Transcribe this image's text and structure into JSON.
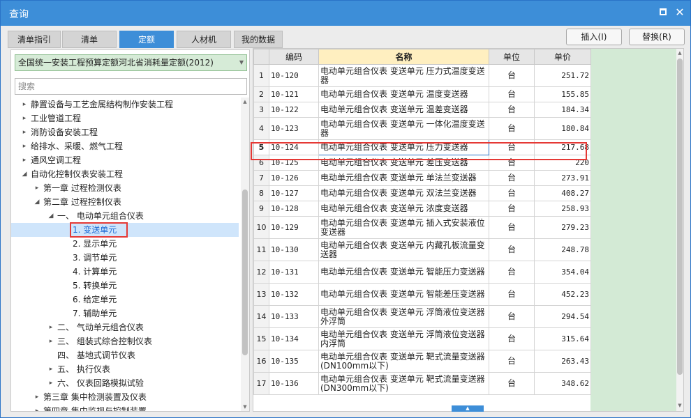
{
  "window": {
    "title": "查询"
  },
  "tabs": [
    {
      "label": "清单指引",
      "active": false
    },
    {
      "label": "清单",
      "active": false
    },
    {
      "label": "定额",
      "active": true
    },
    {
      "label": "人材机",
      "active": false
    },
    {
      "label": "我的数据",
      "active": false
    }
  ],
  "buttons": {
    "insert": "插入(I)",
    "replace": "替换(R)"
  },
  "left": {
    "dropdown_value": "全国统一安装工程预算定额河北省消耗量定额(2012)",
    "search_placeholder": "搜索",
    "tree": [
      {
        "label": "静置设备与工艺金属结构制作安装工程",
        "level": 0,
        "toggle": "▸"
      },
      {
        "label": "工业管道工程",
        "level": 0,
        "toggle": "▸"
      },
      {
        "label": "消防设备安装工程",
        "level": 0,
        "toggle": "▸"
      },
      {
        "label": "给排水、采暖、燃气工程",
        "level": 0,
        "toggle": "▸"
      },
      {
        "label": "通风空调工程",
        "level": 0,
        "toggle": "▸"
      },
      {
        "label": "自动化控制仪表安装工程",
        "level": 0,
        "toggle": "◢"
      },
      {
        "label": "第一章 过程检测仪表",
        "level": 1,
        "toggle": "▸"
      },
      {
        "label": "第二章 过程控制仪表",
        "level": 1,
        "toggle": "◢"
      },
      {
        "label": "一、 电动单元组合仪表",
        "level": 2,
        "toggle": "◢"
      },
      {
        "label": "1. 变送单元",
        "level": 3,
        "toggle": "",
        "selected": true
      },
      {
        "label": "2. 显示单元",
        "level": 3,
        "toggle": ""
      },
      {
        "label": "3. 调节单元",
        "level": 3,
        "toggle": ""
      },
      {
        "label": "4. 计算单元",
        "level": 3,
        "toggle": ""
      },
      {
        "label": "5. 转换单元",
        "level": 3,
        "toggle": ""
      },
      {
        "label": "6. 给定单元",
        "level": 3,
        "toggle": ""
      },
      {
        "label": "7. 辅助单元",
        "level": 3,
        "toggle": ""
      },
      {
        "label": "二、 气动单元组合仪表",
        "level": 2,
        "toggle": "▸"
      },
      {
        "label": "三、 组装式综合控制仪表",
        "level": 2,
        "toggle": "▸"
      },
      {
        "label": "四、 基地式调节仪表",
        "level": 2,
        "toggle": ""
      },
      {
        "label": "五、 执行仪表",
        "level": 2,
        "toggle": "▸"
      },
      {
        "label": "六、 仪表回路模拟试验",
        "level": 2,
        "toggle": "▸"
      },
      {
        "label": "第三章 集中检测装置及仪表",
        "level": 1,
        "toggle": "▸"
      },
      {
        "label": "第四章 集中监视与控制装置",
        "level": 1,
        "toggle": "▸"
      }
    ]
  },
  "table": {
    "headers": [
      "",
      "编码",
      "名称",
      "单位",
      "单价"
    ],
    "rows": [
      {
        "no": "1",
        "code": "10-120",
        "name": "电动单元组合仪表 变送单元 压力式温度变送器",
        "unit": "台",
        "price": "251.72"
      },
      {
        "no": "2",
        "code": "10-121",
        "name": "电动单元组合仪表 变送单元 温度变送器",
        "unit": "台",
        "price": "155.85"
      },
      {
        "no": "3",
        "code": "10-122",
        "name": "电动单元组合仪表 变送单元 温差变送器",
        "unit": "台",
        "price": "184.34"
      },
      {
        "no": "4",
        "code": "10-123",
        "name": "电动单元组合仪表 变送单元 一体化温度变送器",
        "unit": "台",
        "price": "180.84"
      },
      {
        "no": "5",
        "code": "10-124",
        "name": "电动单元组合仪表 变送单元 压力变送器",
        "unit": "台",
        "price": "217.68",
        "selected": true
      },
      {
        "no": "6",
        "code": "10-125",
        "name": "电动单元组合仪表 变送单元 差压变送器",
        "unit": "台",
        "price": "220"
      },
      {
        "no": "7",
        "code": "10-126",
        "name": "电动单元组合仪表 变送单元 单法兰变送器",
        "unit": "台",
        "price": "273.91"
      },
      {
        "no": "8",
        "code": "10-127",
        "name": "电动单元组合仪表 变送单元 双法兰变送器",
        "unit": "台",
        "price": "408.27"
      },
      {
        "no": "9",
        "code": "10-128",
        "name": "电动单元组合仪表 变送单元 浓度变送器",
        "unit": "台",
        "price": "258.93"
      },
      {
        "no": "10",
        "code": "10-129",
        "name": "电动单元组合仪表 变送单元 插入式安装液位变送器",
        "unit": "台",
        "price": "279.23"
      },
      {
        "no": "11",
        "code": "10-130",
        "name": "电动单元组合仪表 变送单元 内藏孔板流量变送器",
        "unit": "台",
        "price": "248.78"
      },
      {
        "no": "12",
        "code": "10-131",
        "name": "电动单元组合仪表 变送单元 智能压力变送器",
        "unit": "台",
        "price": "354.04"
      },
      {
        "no": "13",
        "code": "10-132",
        "name": "电动单元组合仪表 变送单元 智能差压变送器",
        "unit": "台",
        "price": "452.23"
      },
      {
        "no": "14",
        "code": "10-133",
        "name": "电动单元组合仪表 变送单元 浮筒液位变送器 外浮筒",
        "unit": "台",
        "price": "294.54"
      },
      {
        "no": "15",
        "code": "10-134",
        "name": "电动单元组合仪表 变送单元 浮筒液位变送器 内浮筒",
        "unit": "台",
        "price": "315.64"
      },
      {
        "no": "16",
        "code": "10-135",
        "name": "电动单元组合仪表 变送单元 靶式流量变送器(DN100mm以下)",
        "unit": "台",
        "price": "263.43"
      },
      {
        "no": "17",
        "code": "10-136",
        "name": "电动单元组合仪表 变送单元 靶式流量变送器(DN300mm以下)",
        "unit": "台",
        "price": "348.62"
      }
    ]
  },
  "colors": {
    "accent": "#3d8ed8",
    "highlight_box": "#e53935",
    "green_panel": "#d3ead5"
  }
}
